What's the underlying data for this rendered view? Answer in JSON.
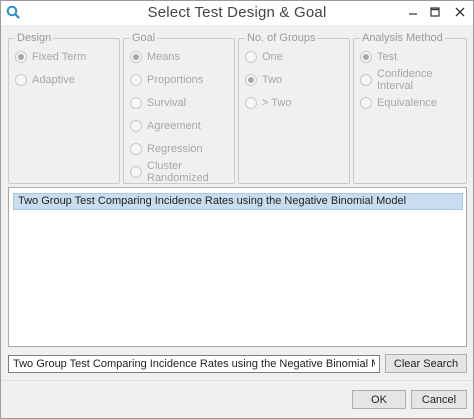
{
  "window": {
    "title": "Select Test Design & Goal"
  },
  "groups": {
    "design": {
      "legend": "Design",
      "options": [
        {
          "label": "Fixed Term",
          "checked": true
        },
        {
          "label": "Adaptive",
          "checked": false
        }
      ]
    },
    "goal": {
      "legend": "Goal",
      "options": [
        {
          "label": "Means",
          "checked": true
        },
        {
          "label": "Proportions",
          "checked": false
        },
        {
          "label": "Survival",
          "checked": false
        },
        {
          "label": "Agreement",
          "checked": false
        },
        {
          "label": "Regression",
          "checked": false
        },
        {
          "label": "Cluster Randomized",
          "checked": false
        }
      ]
    },
    "groups_count": {
      "legend": "No. of Groups",
      "options": [
        {
          "label": "One",
          "checked": false
        },
        {
          "label": "Two",
          "checked": true
        },
        {
          "label": "> Two",
          "checked": false
        }
      ]
    },
    "analysis": {
      "legend": "Analysis Method",
      "options": [
        {
          "label": "Test",
          "checked": true
        },
        {
          "label": "Confidence Interval",
          "checked": false
        },
        {
          "label": "Equivalence",
          "checked": false
        }
      ]
    }
  },
  "results": {
    "items": [
      "Two Group Test Comparing Incidence Rates using the Negative Binomial Model"
    ]
  },
  "search": {
    "value": "Two Group Test Comparing Incidence Rates using the Negative Binomial Model",
    "clear_label": "Clear Search"
  },
  "footer": {
    "ok_label": "OK",
    "cancel_label": "Cancel"
  },
  "icons": {
    "app": "search-logo-icon",
    "minimize": "minimize-icon",
    "maximize": "maximize-icon",
    "close": "close-icon"
  },
  "colors": {
    "selection": "#c8ddf0",
    "close_button": "#c42b1c"
  }
}
